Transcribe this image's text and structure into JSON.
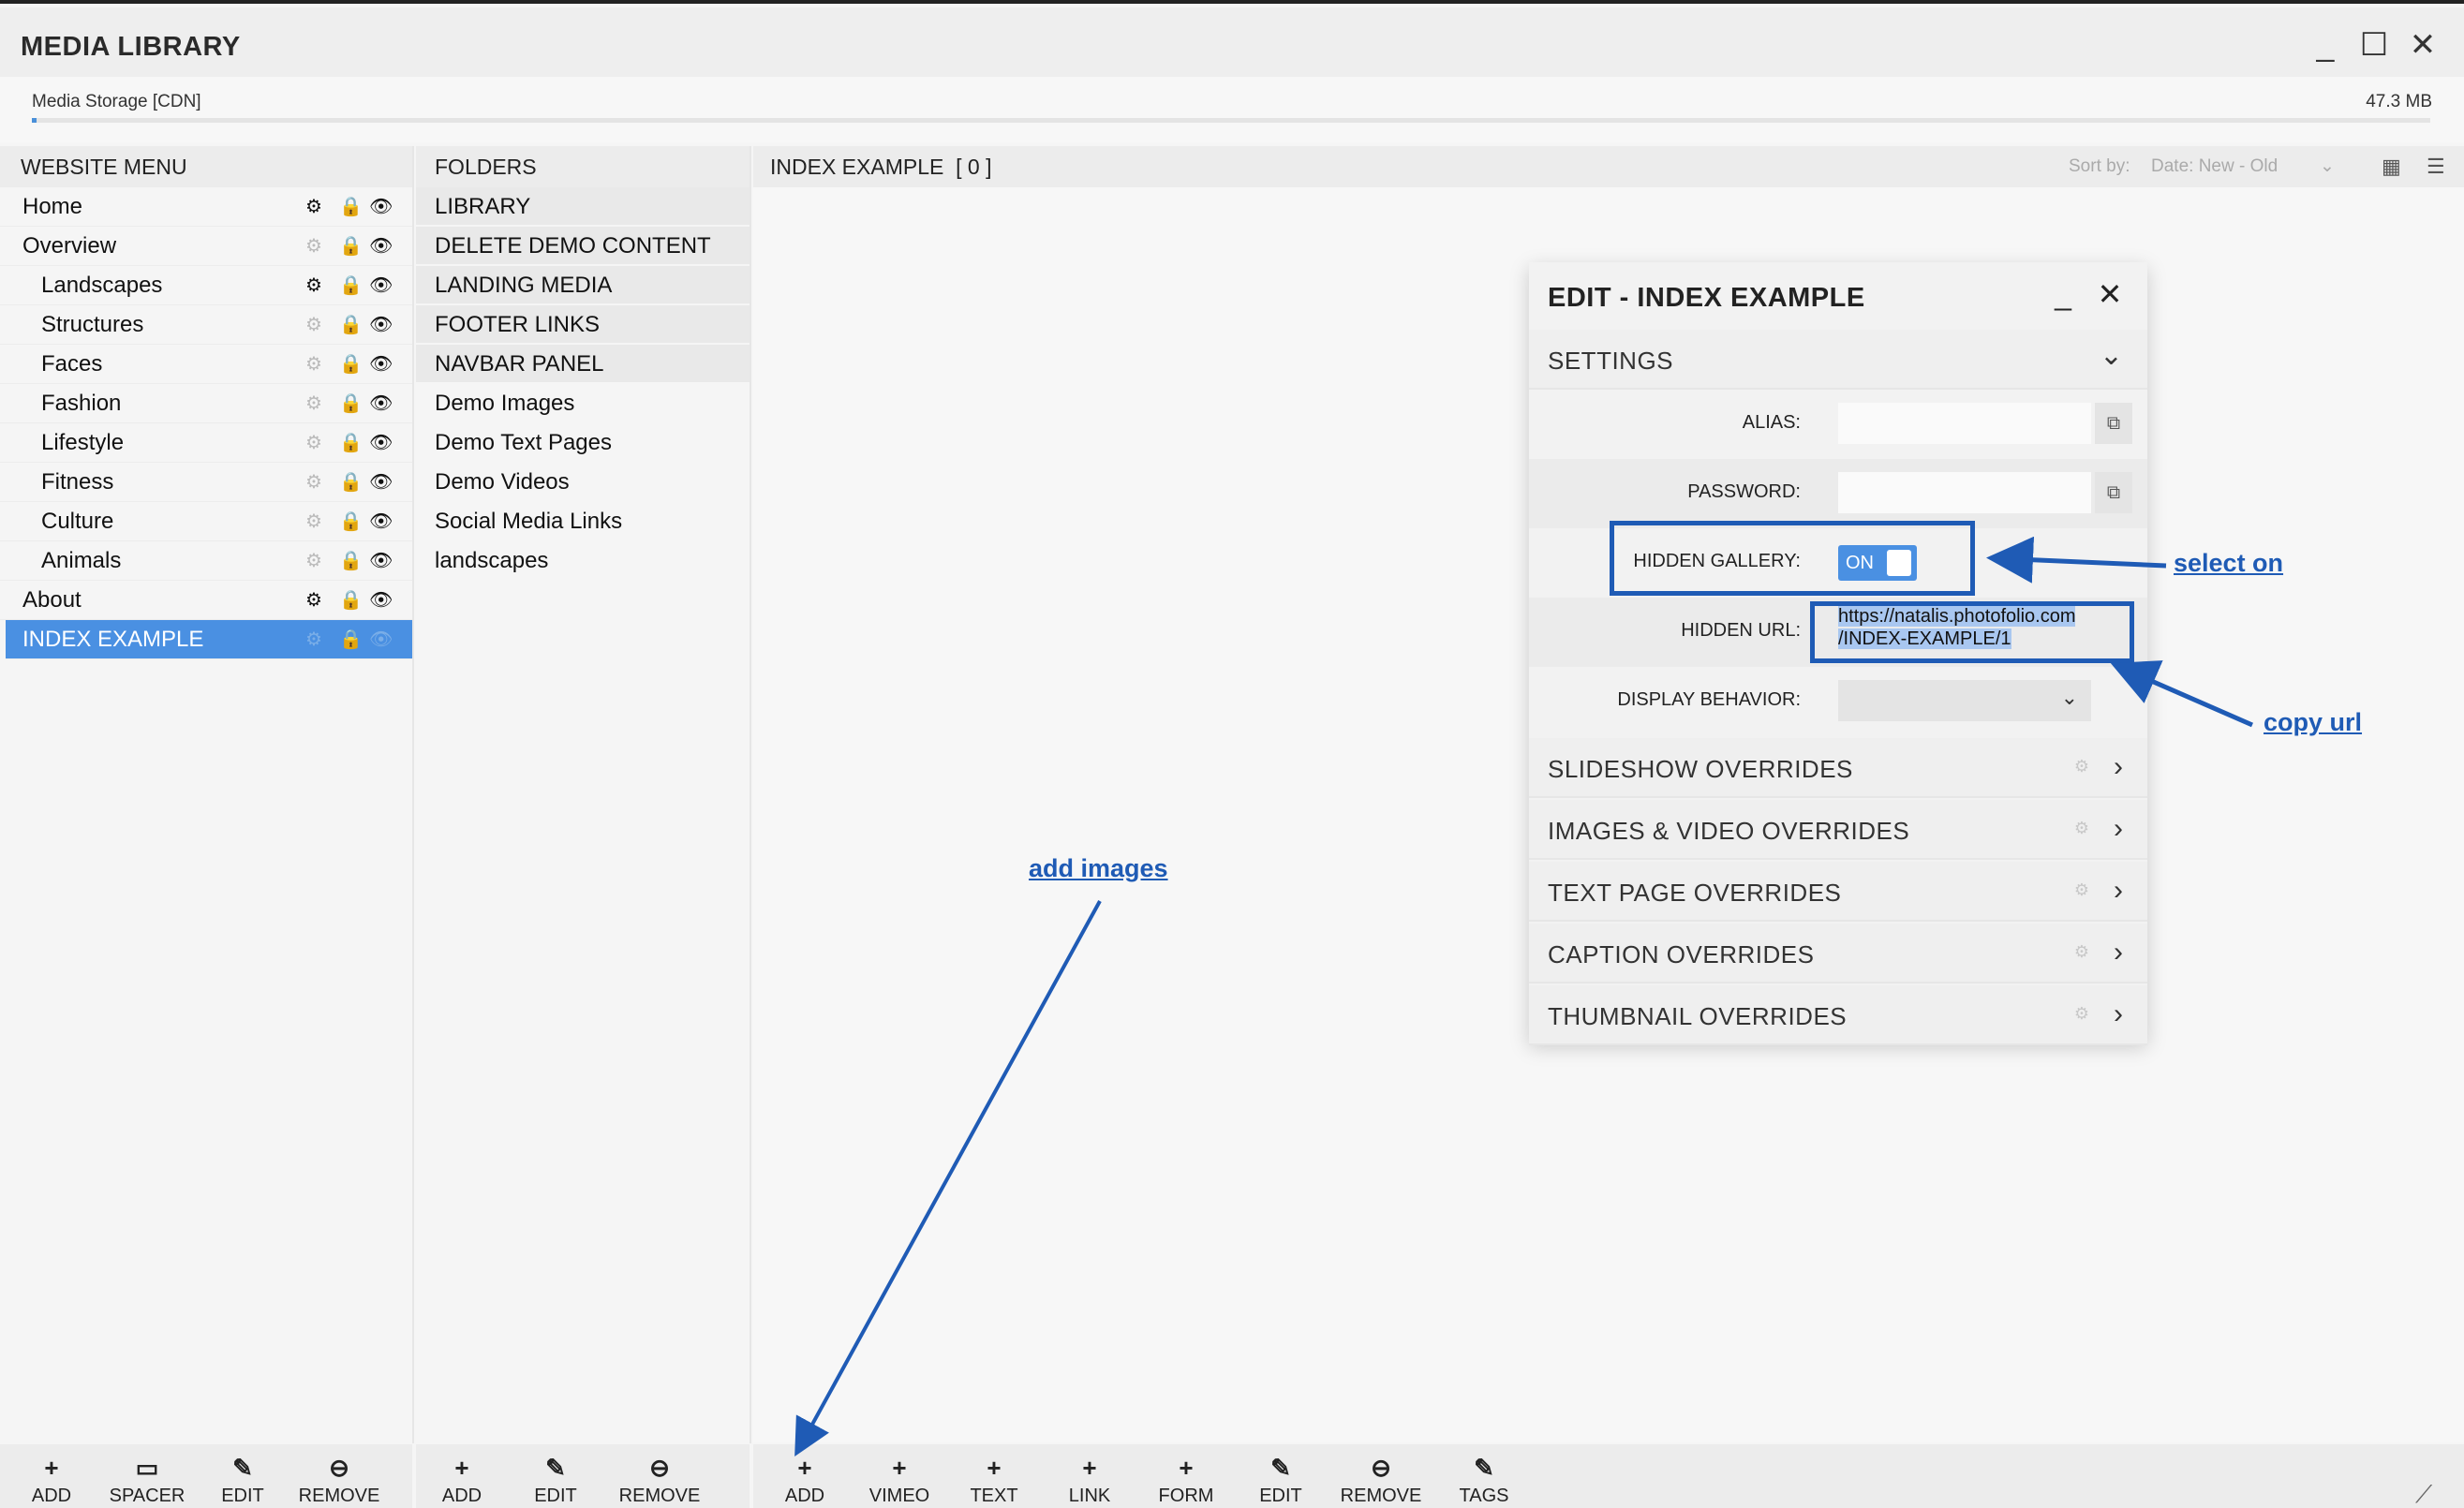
{
  "app": {
    "title": "MEDIA LIBRARY",
    "minimize": "_",
    "maximize": "☐",
    "close": "✕"
  },
  "storage": {
    "label": "Media Storage [CDN]",
    "size": "47.3 MB",
    "usage_fraction": 0.002
  },
  "website_menu": {
    "header": "WEBSITE MENU",
    "items": [
      {
        "label": "Home"
      },
      {
        "label": "Overview"
      },
      {
        "label": "Landscapes"
      },
      {
        "label": "Structures"
      },
      {
        "label": "Faces"
      },
      {
        "label": "Fashion"
      },
      {
        "label": "Lifestyle"
      },
      {
        "label": "Fitness"
      },
      {
        "label": "Culture"
      },
      {
        "label": "Animals"
      },
      {
        "label": "About"
      },
      {
        "label": "INDEX EXAMPLE"
      }
    ],
    "toolbar": [
      {
        "icon": "+",
        "label": "ADD"
      },
      {
        "icon": "▭",
        "label": "SPACER"
      },
      {
        "icon": "✎",
        "label": "EDIT"
      },
      {
        "icon": "⊖",
        "label": "REMOVE"
      }
    ]
  },
  "folders": {
    "header": "FOLDERS",
    "items": [
      {
        "label": "LIBRARY"
      },
      {
        "label": "DELETE DEMO CONTENT"
      },
      {
        "label": "LANDING MEDIA"
      },
      {
        "label": "FOOTER LINKS"
      },
      {
        "label": "NAVBAR PANEL"
      },
      {
        "label": "Demo Images"
      },
      {
        "label": "Demo Text Pages"
      },
      {
        "label": "Demo Videos"
      },
      {
        "label": "Social Media Links"
      },
      {
        "label": "landscapes"
      }
    ],
    "toolbar": [
      {
        "icon": "+",
        "label": "ADD"
      },
      {
        "icon": "✎",
        "label": "EDIT"
      },
      {
        "icon": "⊖",
        "label": "REMOVE"
      }
    ]
  },
  "main": {
    "header": "INDEX EXAMPLE  [ 0 ]",
    "sort_label": "Sort by:",
    "sort_value": "Date: New - Old",
    "toolbar": [
      {
        "icon": "+",
        "label": "ADD"
      },
      {
        "icon": "+",
        "label": "VIMEO"
      },
      {
        "icon": "+",
        "label": "TEXT"
      },
      {
        "icon": "+",
        "label": "LINK"
      },
      {
        "icon": "+",
        "label": "FORM"
      },
      {
        "icon": "✎",
        "label": "EDIT"
      },
      {
        "icon": "⊖",
        "label": "REMOVE"
      },
      {
        "icon": "✎",
        "label": "TAGS"
      }
    ]
  },
  "edit_panel": {
    "title": "EDIT - INDEX EXAMPLE",
    "settings_label": "SETTINGS",
    "alias_label": "ALIAS:",
    "alias_value": "",
    "password_label": "PASSWORD:",
    "password_value": "",
    "hidden_gallery_label": "HIDDEN GALLERY:",
    "hidden_gallery_toggle": "ON",
    "hidden_url_label": "HIDDEN URL:",
    "hidden_url_line1": "https://natalis.photofolio.com",
    "hidden_url_line2": "/INDEX-EXAMPLE/1",
    "display_behavior_label": "DISPLAY BEHAVIOR:",
    "display_behavior_value": "",
    "sections": [
      {
        "label": "SLIDESHOW OVERRIDES"
      },
      {
        "label": "IMAGES & VIDEO OVERRIDES"
      },
      {
        "label": "TEXT PAGE OVERRIDES"
      },
      {
        "label": "CAPTION OVERRIDES"
      },
      {
        "label": "THUMBNAIL OVERRIDES"
      }
    ]
  },
  "annotations": {
    "select_on": "select on",
    "copy_url": "copy url",
    "add_images": "add images",
    "color": "#1f5bb5"
  }
}
